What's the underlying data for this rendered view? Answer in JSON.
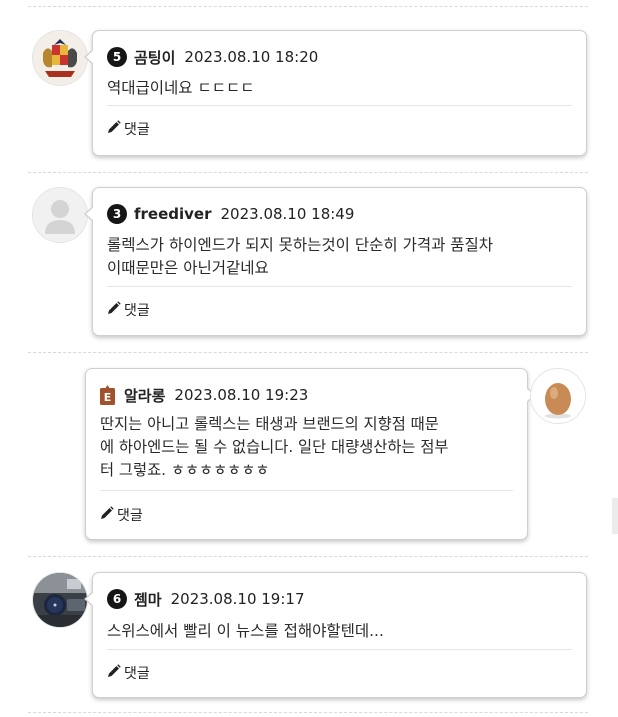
{
  "comments": [
    {
      "level": "5",
      "username": "곰팅이",
      "date": "2023.08.10 18:20",
      "lines": [
        "역대급이네요 ㄷㄷㄷㄷ"
      ],
      "reply_label": "댓글",
      "avatar_icon": "crest-avatar-icon"
    },
    {
      "level": "3",
      "username": "freediver",
      "date": "2023.08.10 18:49",
      "lines": [
        "롤렉스가 하이엔드가 되지 못하는것이 단순히 가격과 품질차",
        "이때문만은 아닌거같네요"
      ],
      "reply_label": "댓글",
      "avatar_icon": "default-person-icon"
    },
    {
      "level": "E",
      "username": "알라롱",
      "date": "2023.08.10 19:23",
      "lines": [
        "딴지는 아니고 롤렉스는 태생과 브랜드의 지향점 때문",
        "에 하아엔드는 될 수 없습니다. 일단 대량생산하는 점부",
        "터 그렇죠. ㅎㅎㅎㅎㅎㅎㅎ"
      ],
      "reply_label": "댓글",
      "avatar_icon": "egg-avatar-icon"
    },
    {
      "level": "6",
      "username": "젬마",
      "date": "2023.08.10 19:17",
      "lines": [
        "스위스에서 빨리 이 뉴스를 접해야할텐데..."
      ],
      "reply_label": "댓글",
      "avatar_icon": "watch-avatar-icon"
    }
  ],
  "colors": {
    "level_badge": "#161616",
    "manager_badge": "#a0522d",
    "bubble_border": "#cfcfcf",
    "separator": "#d9d9d9"
  }
}
